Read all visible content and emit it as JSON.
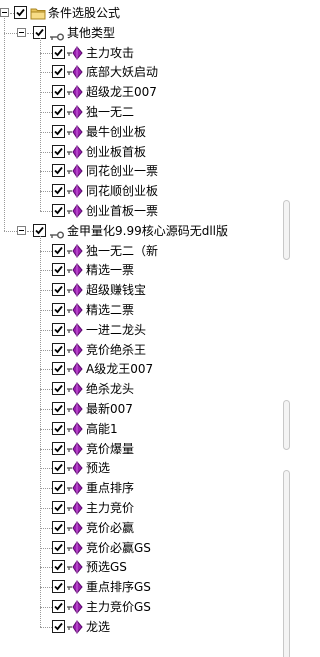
{
  "tree": {
    "root": {
      "label": "条件选股公式",
      "checked": true,
      "expanded": true,
      "icon": "folder-icon"
    },
    "groups": [
      {
        "label": "其他类型",
        "checked": true,
        "expanded": true,
        "icon": "key-icon",
        "items": [
          {
            "label": "主力攻击",
            "checked": true
          },
          {
            "label": "底部大妖启动",
            "checked": true
          },
          {
            "label": "超级龙王007",
            "checked": true
          },
          {
            "label": "独一无二",
            "checked": true
          },
          {
            "label": "最牛创业板",
            "checked": true
          },
          {
            "label": "创业板首板",
            "checked": true
          },
          {
            "label": "同花创业一票",
            "checked": true
          },
          {
            "label": "同花顺创业板",
            "checked": true
          },
          {
            "label": "创业首板一票",
            "checked": true
          }
        ]
      },
      {
        "label": "金甲量化9.99核心源码无dll版",
        "checked": true,
        "expanded": true,
        "icon": "key-icon",
        "items": [
          {
            "label": "独一无二（新",
            "checked": true
          },
          {
            "label": "精选一票",
            "checked": true
          },
          {
            "label": "超级赚钱宝",
            "checked": true
          },
          {
            "label": "精选二票",
            "checked": true
          },
          {
            "label": "一进二龙头",
            "checked": true
          },
          {
            "label": "竞价绝杀王",
            "checked": true
          },
          {
            "label": "A级龙王007",
            "checked": true
          },
          {
            "label": "绝杀龙头",
            "checked": true
          },
          {
            "label": "最新007",
            "checked": true
          },
          {
            "label": "高能1",
            "checked": true
          },
          {
            "label": "竞价爆量",
            "checked": true
          },
          {
            "label": "预选",
            "checked": true
          },
          {
            "label": "重点排序",
            "checked": true
          },
          {
            "label": "主力竞价",
            "checked": true
          },
          {
            "label": "竞价必赢",
            "checked": true
          },
          {
            "label": "竞价必赢GS",
            "checked": true
          },
          {
            "label": "预选GS",
            "checked": true
          },
          {
            "label": "重点排序GS",
            "checked": true
          },
          {
            "label": "主力竞价GS",
            "checked": true
          },
          {
            "label": "龙选",
            "checked": true
          }
        ]
      }
    ],
    "item_icon": "formula-gem-icon"
  },
  "colors": {
    "gem": "#9b1fb0",
    "gem_dark": "#5c0c6e",
    "key": "#555555",
    "folder": "#e8c35a",
    "tree_line": "#999999"
  }
}
